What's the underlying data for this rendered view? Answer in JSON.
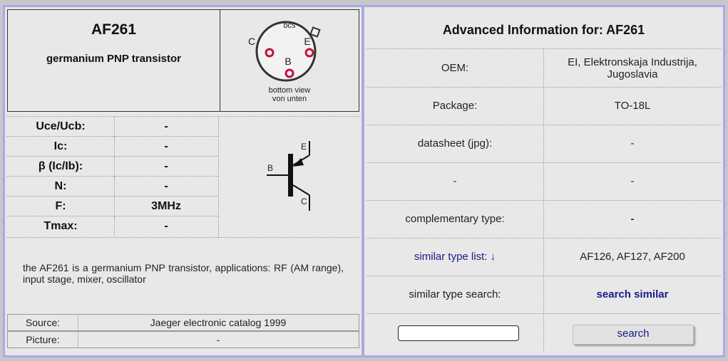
{
  "part": {
    "name": "AF261",
    "subtitle": "germanium PNP transistor"
  },
  "package_diagram": {
    "pins_label": "bcs",
    "pin_c": "C",
    "pin_e": "E",
    "pin_b": "B",
    "caption_line1": "bottom view",
    "caption_line2": "von unten"
  },
  "symbol": {
    "label_e": "E",
    "label_b": "B",
    "label_c": "C"
  },
  "params": [
    {
      "label": "Uce/Ucb:",
      "value": "-"
    },
    {
      "label": "Ic:",
      "value": "-"
    },
    {
      "label": "β (Ic/Ib):",
      "value": "-"
    },
    {
      "label": "N:",
      "value": "-"
    },
    {
      "label": "F:",
      "value": "3MHz"
    },
    {
      "label": "Tmax:",
      "value": "-"
    }
  ],
  "description": "the AF261 is a germanium PNP transistor, applications: RF (AM range), input stage, mixer, oscillator",
  "source": {
    "label": "Source:",
    "value": "Jaeger electronic catalog 1999"
  },
  "picture": {
    "label": "Picture:",
    "value": "-"
  },
  "advanced": {
    "title": "Advanced Information for: AF261",
    "rows": [
      {
        "label": "OEM:",
        "value": "EI, Elektronskaja Industrija, Jugoslavia"
      },
      {
        "label": "Package:",
        "value": "TO-18L"
      },
      {
        "label": "datasheet (jpg):",
        "value": "-"
      },
      {
        "label": "-",
        "value": "-"
      },
      {
        "label": "complementary type:",
        "value": "-"
      },
      {
        "label": "similar type list: ↓",
        "value": "AF126, AF127, AF200"
      },
      {
        "label": "similar type search:",
        "value": "search similar"
      }
    ],
    "search_input_value": "",
    "search_button": "search"
  },
  "colors": {
    "frame": "#a9a9e6",
    "panel": "#e8e8e8",
    "link": "#1a1a8c",
    "pin": "#c0143c"
  }
}
